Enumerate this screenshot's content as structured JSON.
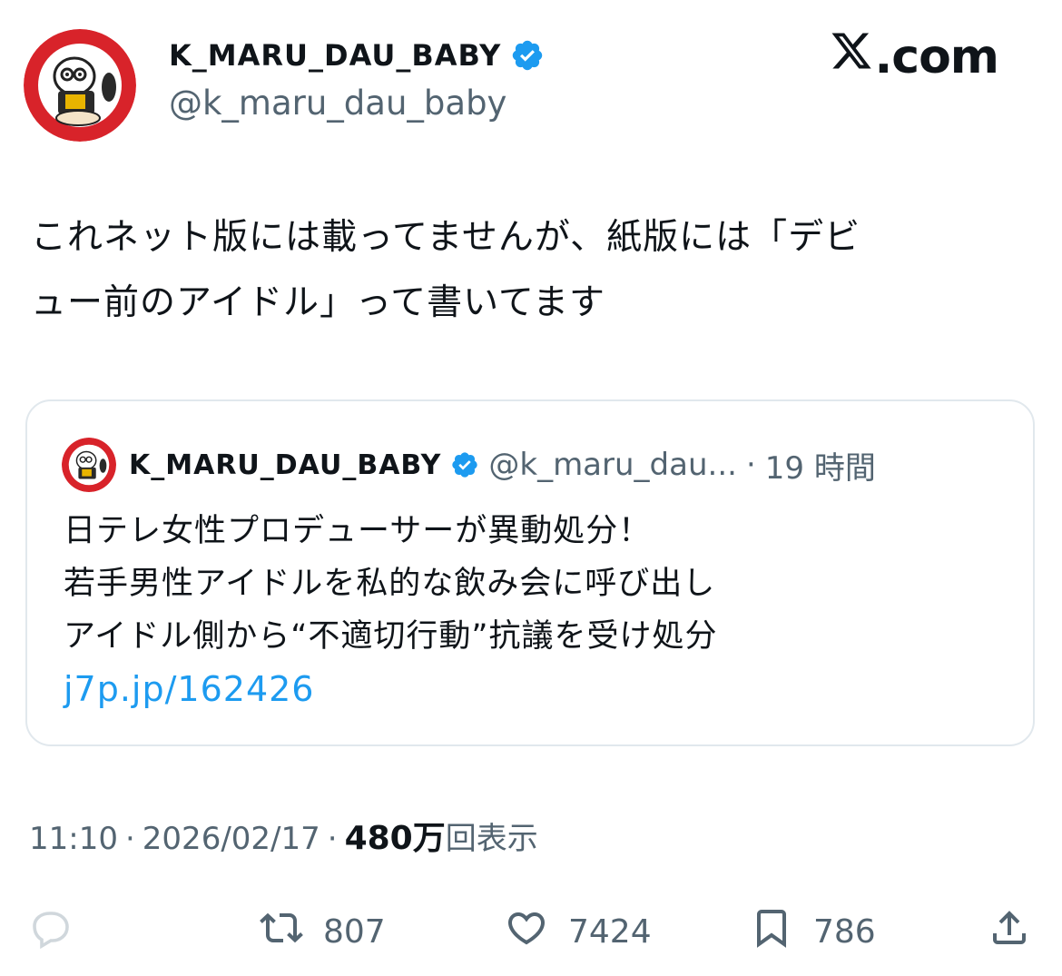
{
  "header": {
    "display_name": "K_MARU_DAU_BABY",
    "handle": "@k_maru_dau_baby",
    "brand": "X.com",
    "brand_suffix": ".com"
  },
  "tweet": {
    "text_line1": "これネット版には載ってませんが、紙版には「デビ",
    "text_line2": "ュー前のアイドル」って書いてます"
  },
  "quote": {
    "display_name": "K_MARU_DAU_BABY",
    "handle": "@k_maru_dau...",
    "dot": "·",
    "time": "19 時間",
    "line1": "日テレ女性プロデューサーが異動処分！",
    "line2": "若手男性アイドルを私的な飲み会に呼び出し",
    "line3": "アイドル側から“不適切行動”抗議を受け処分",
    "link": "j7p.jp/162426"
  },
  "meta": {
    "time": "11:10",
    "sep1": "·",
    "date": "2026/02/17",
    "sep2": "·",
    "views_count": "480万",
    "views_label": "回表示"
  },
  "actions": {
    "retweets": "807",
    "likes": "7424",
    "bookmarks": "786"
  },
  "colors": {
    "accent": "#1d9bf0",
    "text": "#0f1419",
    "muted": "#536471",
    "avatar_ring": "#d8232a"
  },
  "icons": [
    "verified-badge-icon",
    "x-logo-icon",
    "reply-icon",
    "retweet-icon",
    "like-icon",
    "bookmark-icon",
    "share-icon"
  ]
}
